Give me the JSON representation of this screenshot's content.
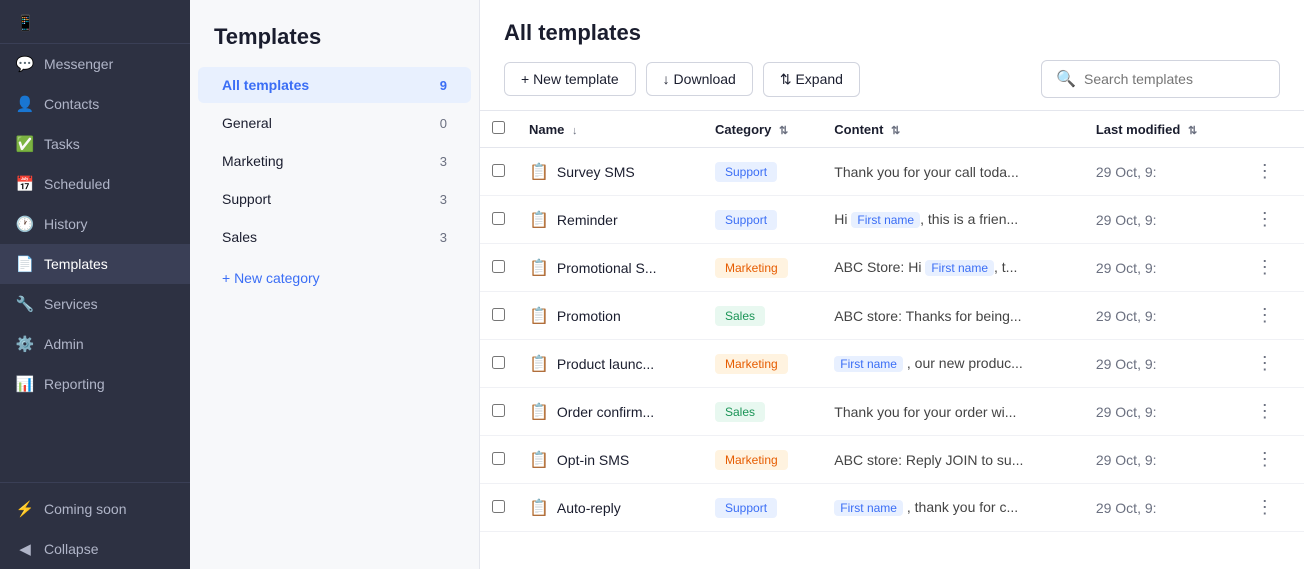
{
  "sidebar": {
    "items": [
      {
        "id": "messenger",
        "label": "Messenger",
        "icon": "💬"
      },
      {
        "id": "contacts",
        "label": "Contacts",
        "icon": "👤"
      },
      {
        "id": "tasks",
        "label": "Tasks",
        "icon": "✅"
      },
      {
        "id": "scheduled",
        "label": "Scheduled",
        "icon": "📅"
      },
      {
        "id": "history",
        "label": "History",
        "icon": "🕐"
      },
      {
        "id": "templates",
        "label": "Templates",
        "icon": "📄",
        "active": true
      },
      {
        "id": "services",
        "label": "Services",
        "icon": "🔧"
      },
      {
        "id": "admin",
        "label": "Admin",
        "icon": "⚙️"
      },
      {
        "id": "reporting",
        "label": "Reporting",
        "icon": "📊"
      },
      {
        "id": "coming-soon",
        "label": "Coming soon",
        "icon": "⚡"
      },
      {
        "id": "collapse",
        "label": "Collapse",
        "icon": "◀"
      }
    ]
  },
  "left_panel": {
    "title": "Templates",
    "categories": [
      {
        "id": "all",
        "label": "All templates",
        "count": 9,
        "active": true
      },
      {
        "id": "general",
        "label": "General",
        "count": 0
      },
      {
        "id": "marketing",
        "label": "Marketing",
        "count": 3
      },
      {
        "id": "support",
        "label": "Support",
        "count": 3
      },
      {
        "id": "sales",
        "label": "Sales",
        "count": 3
      }
    ],
    "new_category_label": "+ New category"
  },
  "main": {
    "title": "All templates",
    "toolbar": {
      "new_template": "+ New template",
      "download": "↓ Download",
      "expand": "⇅ Expand",
      "search_placeholder": "Search templates"
    },
    "table": {
      "columns": [
        "Name",
        "Category",
        "Content",
        "Last modified"
      ],
      "rows": [
        {
          "name": "Survey SMS",
          "category": "Support",
          "category_type": "support",
          "content_pre": "Thank you for your call toda...",
          "has_firstname": false,
          "date": "29 Oct, 9:"
        },
        {
          "name": "Reminder",
          "category": "Support",
          "category_type": "support",
          "content_pre": "Hi ",
          "firstname_tag": "First name",
          "content_post": ", this is a frien...",
          "has_firstname": true,
          "date": "29 Oct, 9:"
        },
        {
          "name": "Promotional S...",
          "category": "Marketing",
          "category_type": "marketing",
          "content_pre": "ABC Store: Hi ",
          "firstname_tag": "First name",
          "content_post": ", t...",
          "has_firstname": true,
          "date": "29 Oct, 9:"
        },
        {
          "name": "Promotion",
          "category": "Sales",
          "category_type": "sales",
          "content_pre": "ABC store: Thanks for being...",
          "has_firstname": false,
          "date": "29 Oct, 9:"
        },
        {
          "name": "Product launc...",
          "category": "Marketing",
          "category_type": "marketing",
          "content_pre": "",
          "firstname_tag": "First name",
          "content_post": ", our new produc...",
          "has_firstname": true,
          "firstname_first": true,
          "date": "29 Oct, 9:"
        },
        {
          "name": "Order confirm...",
          "category": "Sales",
          "category_type": "sales",
          "content_pre": "Thank you for your order wi...",
          "has_firstname": false,
          "date": "29 Oct, 9:"
        },
        {
          "name": "Opt-in SMS",
          "category": "Marketing",
          "category_type": "marketing",
          "content_pre": "ABC store: Reply JOIN to su...",
          "has_firstname": false,
          "date": "29 Oct, 9:"
        },
        {
          "name": "Auto-reply",
          "category": "Support",
          "category_type": "support",
          "content_pre": "",
          "firstname_tag": "First name",
          "content_post": ", thank you for c...",
          "has_firstname": true,
          "firstname_first": true,
          "date": "29 Oct, 9:"
        }
      ]
    }
  }
}
